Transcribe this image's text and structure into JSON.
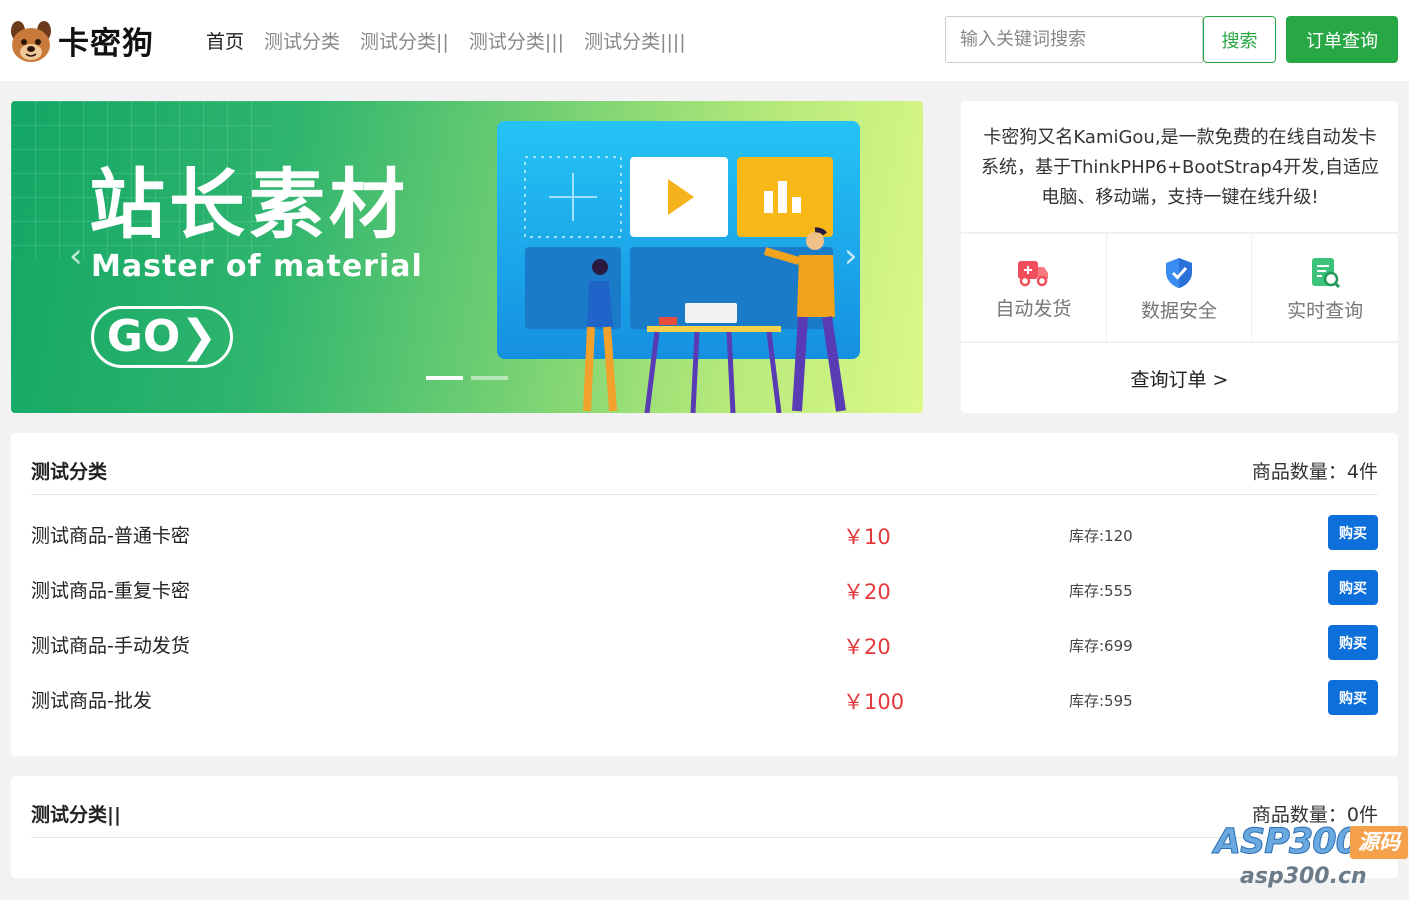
{
  "header": {
    "logo_text": "卡密狗",
    "nav": [
      {
        "label": "首页"
      },
      {
        "label": "测试分类"
      },
      {
        "label": "测试分类||"
      },
      {
        "label": "测试分类|||"
      },
      {
        "label": "测试分类||||"
      }
    ],
    "search_placeholder": "输入关键词搜索",
    "search_label": "搜索",
    "order_query_label": "订单查询",
    "accent_color": "#28a745"
  },
  "banner": {
    "title": "站长素材",
    "subtitle": "Master of material",
    "go_label": "GO❯",
    "prev_arrow": "‹",
    "next_arrow": "›",
    "active_slide": 1,
    "slide_count": 2
  },
  "info": {
    "description": "卡密狗又名KamiGou,是一款免费的在线自动发卡系统，基于ThinkPHP6+BootStrap4开发,自适应电脑、移动端，支持一键在线升级!",
    "features": [
      {
        "label": "自动发货",
        "icon": "truck-icon"
      },
      {
        "label": "数据安全",
        "icon": "shield-check-icon"
      },
      {
        "label": "实时查询",
        "icon": "document-search-icon"
      }
    ],
    "query_link": "查询订单 >"
  },
  "categories": [
    {
      "title": "测试分类",
      "count_label": "商品数量：4件",
      "items": [
        {
          "name": "测试商品-普通卡密",
          "price": "￥10",
          "stock": "库存:120",
          "buy": "购买"
        },
        {
          "name": "测试商品-重复卡密",
          "price": "￥20",
          "stock": "库存:555",
          "buy": "购买"
        },
        {
          "name": "测试商品-手动发货",
          "price": "￥20",
          "stock": "库存:699",
          "buy": "购买"
        },
        {
          "name": "测试商品-批发",
          "price": "￥100",
          "stock": "库存:595",
          "buy": "购买"
        }
      ]
    },
    {
      "title": "测试分类||",
      "count_label": "商品数量：0件",
      "items": []
    }
  ],
  "watermark": {
    "main": "ASP300",
    "tag": "源码",
    "url": "asp300.cn"
  },
  "colors": {
    "price": "#e4393c",
    "buy_button": "#0d6fd9"
  }
}
